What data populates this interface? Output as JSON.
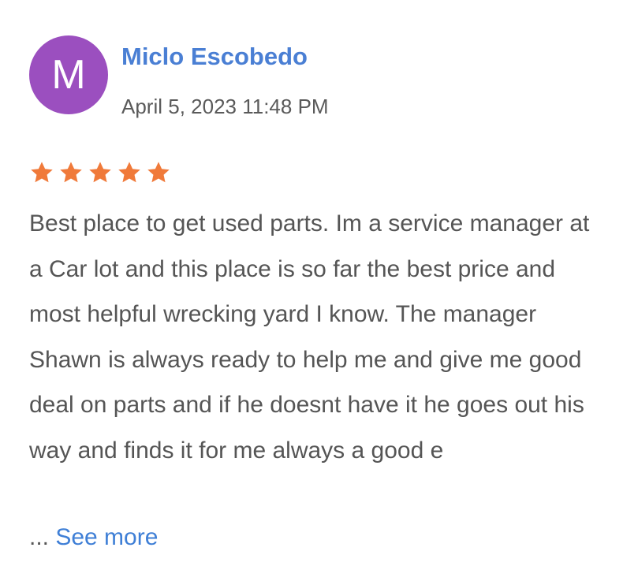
{
  "review": {
    "avatar_letter": "M",
    "avatar_color": "#9b4fbf",
    "reviewer_name": "Miclo Escobedo",
    "date": "April 5, 2023 11:48 PM",
    "rating": 5,
    "rating_max": 5,
    "star_color": "#f07a3a",
    "text": "Best place to get used parts. Im a service manager at a Car lot and this place is so far the best price and most helpful wrecking yard I know. The manager Shawn is always ready to help me and give me good deal on parts and if he doesnt have it he goes out his way and finds it for me always a good e",
    "ellipsis": "...",
    "see_more_label": "See more"
  }
}
